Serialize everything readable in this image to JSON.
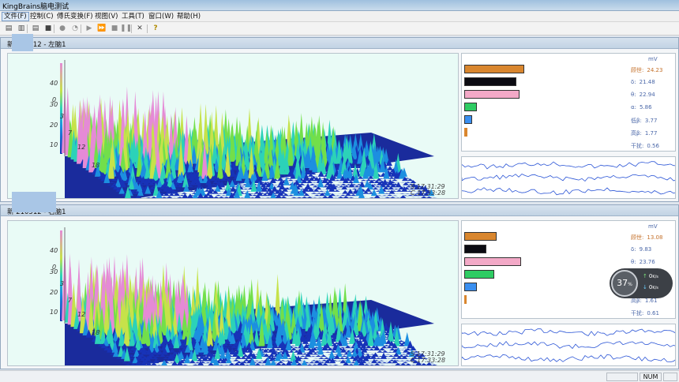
{
  "window": {
    "title": "KingBrains脑电测试"
  },
  "menu": [
    {
      "label": "文件(F)",
      "active": true
    },
    {
      "label": "控制(C)"
    },
    {
      "label": "傅氏变换(F)"
    },
    {
      "label": "视图(V)"
    },
    {
      "label": "工具(T)"
    },
    {
      "label": "窗口(W)"
    },
    {
      "label": "帮助(H)"
    }
  ],
  "toolbar": [
    {
      "icon": "open-folder-icon",
      "glyph": "▤"
    },
    {
      "icon": "save-disabled-icon",
      "glyph": "▥"
    },
    {
      "icon": "open-file-icon",
      "glyph": "▤"
    },
    {
      "icon": "save-icon",
      "glyph": "■"
    },
    {
      "icon": "record-icon",
      "glyph": "●"
    },
    {
      "icon": "timer-icon",
      "glyph": "◔"
    },
    {
      "icon": "play-icon",
      "glyph": "▶"
    },
    {
      "icon": "fast-forward-icon",
      "glyph": "⏩"
    },
    {
      "icon": "stop-icon",
      "glyph": "■"
    },
    {
      "icon": "pause-icon",
      "glyph": "❚❚"
    },
    {
      "icon": "close-icon",
      "glyph": "✕"
    },
    {
      "icon": "help-icon",
      "glyph": "?"
    }
  ],
  "panels": [
    {
      "title": "新 210512 - 左脑1",
      "yticks": [
        "40",
        "30",
        "20",
        "10"
      ],
      "xticks": [
        "0",
        "3",
        "7",
        "12",
        "18"
      ],
      "time_s": "S 17:31:29",
      "time_c": "C 17:33:28",
      "unit": "mV",
      "bands": [
        {
          "name": "顾世:",
          "value": "24.23",
          "color": "#d9862e"
        },
        {
          "name": "δ:",
          "value": "21.48",
          "color": "#0b0b12"
        },
        {
          "name": "θ:",
          "value": "22.94",
          "color": "#f3a9c7"
        },
        {
          "name": "α:",
          "value": "5.86",
          "color": "#2ecc63"
        },
        {
          "name": "低β:",
          "value": "3.77",
          "color": "#3a8ff0"
        },
        {
          "name": "高β:",
          "value": "1.77",
          "color": "#d9862e"
        },
        {
          "name": "干扰:",
          "value": "0.56",
          "color": "#9aa0a6"
        }
      ]
    },
    {
      "title": "新 210512 - 右脑1",
      "yticks": [
        "40",
        "30",
        "20",
        "10"
      ],
      "xticks": [
        "0",
        "3",
        "7",
        "12",
        "18"
      ],
      "time_s": "S 17:31:29",
      "time_c": "C 17:33:28",
      "unit": "mV",
      "bands": [
        {
          "name": "顾世:",
          "value": "13.08",
          "color": "#d9862e"
        },
        {
          "name": "δ:",
          "value": "9.83",
          "color": "#0b0b12"
        },
        {
          "name": "θ:",
          "value": "23.76",
          "color": "#f3a9c7"
        },
        {
          "name": "α:",
          "value": "",
          "color": "#2ecc63"
        },
        {
          "name": "低β:",
          "value": "",
          "color": "#3a8ff0"
        },
        {
          "name": "高β:",
          "value": "1.61",
          "color": "#d9862e"
        },
        {
          "name": "干扰:",
          "value": "0.61",
          "color": "#9aa0a6"
        }
      ]
    }
  ],
  "statusbar": {
    "num": "NUM"
  },
  "widget": {
    "percent": "37",
    "percent_unit": "%",
    "up": "0",
    "up_unit": "K/s",
    "down": "0",
    "down_unit": "K/s"
  }
}
